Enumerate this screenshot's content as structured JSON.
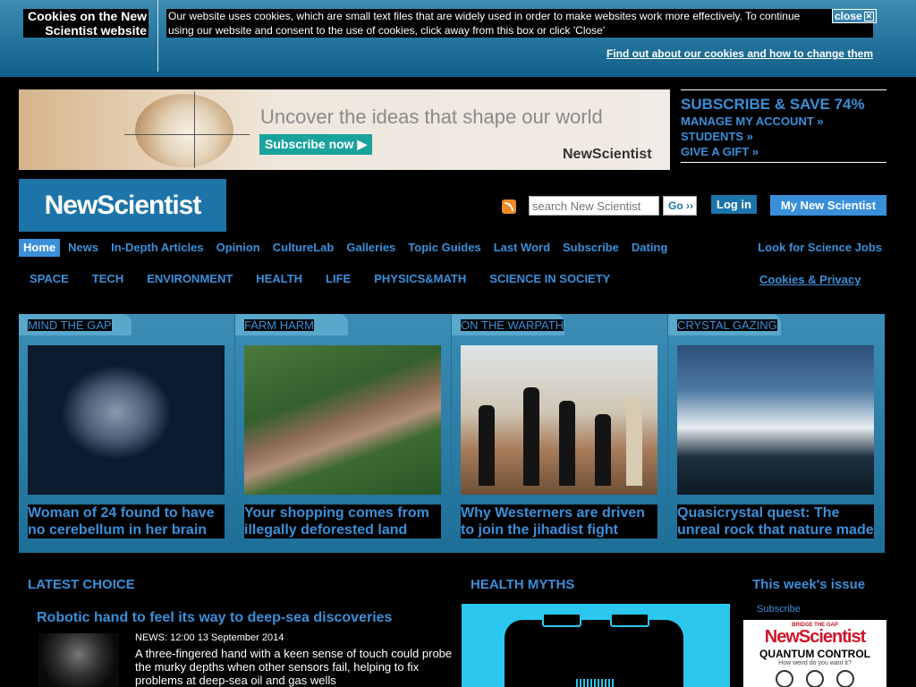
{
  "cookie": {
    "title": "Cookies on the New Scientist website",
    "text": "Our website uses cookies, which are small text files that are widely used in order to make websites work more effectively. To continue using our website and consent to the use of cookies, click away from this box or click 'Close'",
    "close_label": "close",
    "close_icon": "close-x-icon",
    "find_out": "Find out about our cookies and how to change them"
  },
  "banner": {
    "tagline": "Uncover the ideas that shape our world",
    "subscribe_label": "Subscribe now ▶",
    "logo": "NewScientist"
  },
  "subscribe_box": {
    "headline": "SUBSCRIBE & SAVE 74%",
    "links": [
      "MANAGE MY ACCOUNT »",
      "STUDENTS »",
      "GIVE A GIFT »"
    ]
  },
  "header": {
    "logo": "NewScientist",
    "rss_icon": "rss-icon",
    "search_placeholder": "search New Scientist",
    "go_label": "Go ››",
    "login_label": "Log in",
    "my_ns_label": "My New Scientist"
  },
  "nav": {
    "primary": [
      "Home",
      "News",
      "In-Depth Articles",
      "Opinion",
      "CultureLab",
      "Galleries",
      "Topic Guides",
      "Last Word",
      "Subscribe",
      "Dating"
    ],
    "active": "Home",
    "jobs": "Look for Science Jobs",
    "sections": [
      "SPACE",
      "TECH",
      "ENVIRONMENT",
      "HEALTH",
      "LIFE",
      "PHYSICS&MATH",
      "SCIENCE IN SOCIETY"
    ],
    "privacy": "Cookies & Privacy"
  },
  "featured": [
    {
      "kicker": "MIND THE GAP",
      "headline": "Woman of 24 found to have no cerebellum in her brain",
      "image": "brain-mri-image"
    },
    {
      "kicker": "FARM HARM",
      "headline": "Your shopping comes from illegally deforested land",
      "image": "deforested-land-image"
    },
    {
      "kicker": "ON THE WARPATH",
      "headline": "Why Westerners are driven to join the jihadist fight",
      "image": "militants-image"
    },
    {
      "kicker": "CRYSTAL GAZING",
      "headline": "Quasicrystal quest: The unreal rock that nature made",
      "image": "quasicrystal-image"
    }
  ],
  "latest": {
    "heading": "LATEST CHOICE",
    "story_title": "Robotic hand to feel its way to deep-sea discoveries",
    "story_meta": "NEWS:  12:00 13 September 2014",
    "story_desc": "A three-fingered hand with a keen sense of touch could probe the murky depths when other sensors fail, helping to fix problems at deep-sea oil and gas wells"
  },
  "health_myths": {
    "heading": "HEALTH MYTHS"
  },
  "weekly": {
    "heading": "This week's issue",
    "subscribe": "Subscribe",
    "cover_top": "BRIDGE THE GAP",
    "cover_title": "NewScientist",
    "cover_headline": "QUANTUM CONTROL",
    "cover_sub": "How weird do you want it?"
  }
}
